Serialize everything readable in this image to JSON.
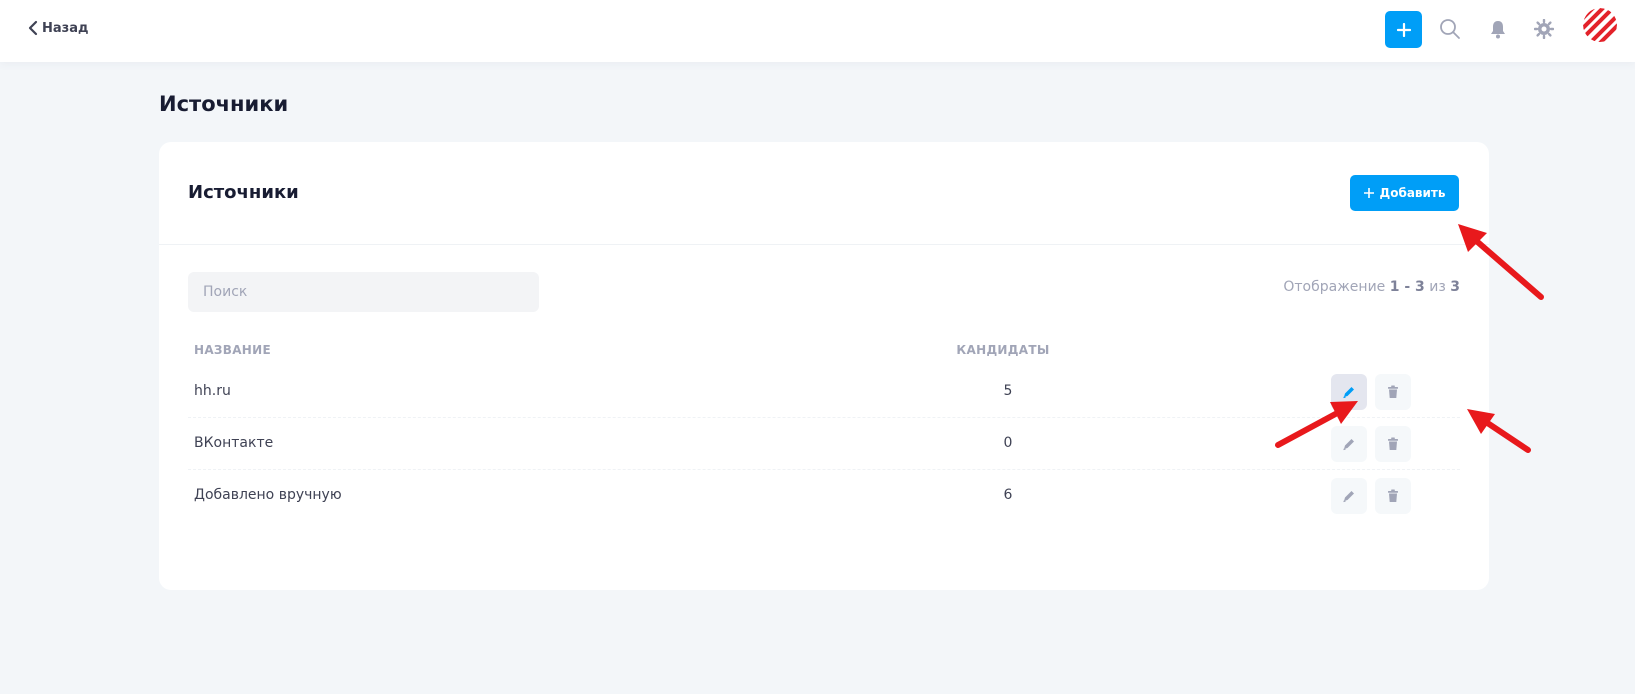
{
  "topbar": {
    "back_label": "Назад"
  },
  "page": {
    "title": "Источники"
  },
  "card": {
    "title": "Источники",
    "add_button_label": "Добавить",
    "search_placeholder": "Поиск",
    "paging": {
      "prefix": "Отображение",
      "range": "1 - 3",
      "of": "из",
      "total": "3"
    },
    "columns": {
      "name": "НАЗВАНИЕ",
      "candidates": "КАНДИДАТЫ"
    },
    "rows": [
      {
        "name": "hh.ru",
        "candidates": "5"
      },
      {
        "name": "ВКонтакте",
        "candidates": "0"
      },
      {
        "name": "Добавлено вручную",
        "candidates": "6"
      }
    ]
  },
  "colors": {
    "accent": "#009ef7",
    "annotation_arrow": "#e8191c",
    "page_bg": "#f3f6f9"
  },
  "icons": [
    "chevron-left-icon",
    "plus-icon",
    "search-icon",
    "bell-icon",
    "gear-icon",
    "avatar-logo",
    "pencil-icon",
    "trash-icon"
  ]
}
